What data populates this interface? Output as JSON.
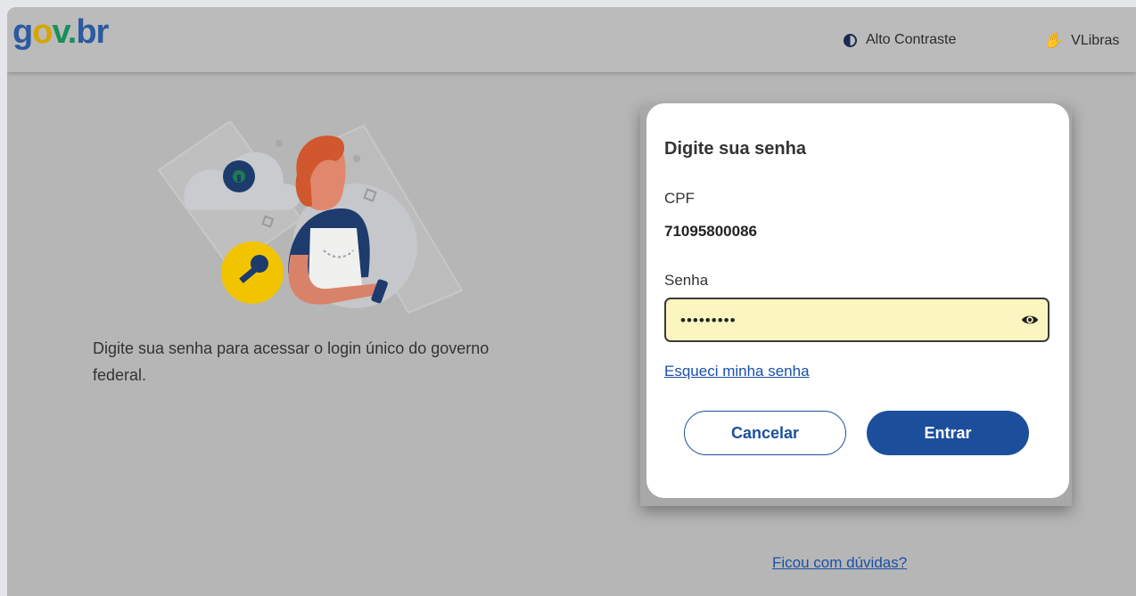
{
  "header": {
    "logo": {
      "g": "g",
      "o": "o",
      "v": "v",
      "dot": ".",
      "br": "br"
    },
    "contrast_label": "Alto Contraste",
    "vlibras_label": "VLibras"
  },
  "intro": {
    "description": "Digite sua senha para acessar o login único do governo federal."
  },
  "login_modal": {
    "title": "Digite sua senha",
    "cpf_label": "CPF",
    "cpf_value": "71095800086",
    "password_label": "Senha",
    "password_masked": "•••••••••",
    "forgot_link": "Esqueci minha senha",
    "cancel_label": "Cancelar",
    "submit_label": "Entrar"
  },
  "footer": {
    "help_link": "Ficou com dúvidas?"
  },
  "colors": {
    "primary": "#1b4f9c",
    "password_field_bg": "#fbf6bf",
    "overlay": "#b6b6b6"
  },
  "icons": [
    "contrast-icon",
    "vlibras-hand-icon",
    "eye-icon",
    "lock-icon",
    "key-icon"
  ]
}
